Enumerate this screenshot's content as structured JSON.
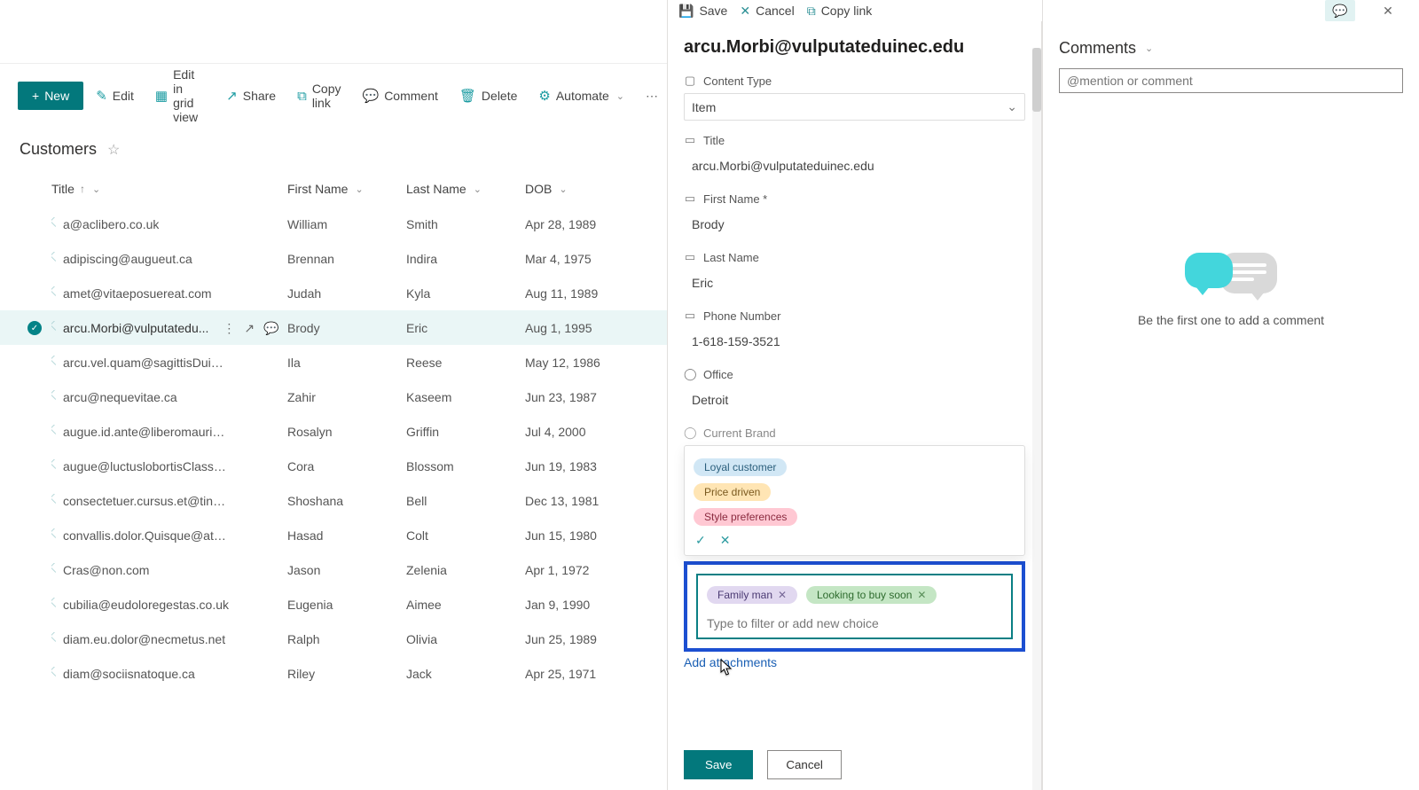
{
  "command_bar": {
    "new": "New",
    "edit": "Edit",
    "edit_grid": "Edit in grid view",
    "share": "Share",
    "copy_link": "Copy link",
    "comment": "Comment",
    "delete": "Delete",
    "automate": "Automate"
  },
  "list": {
    "title": "Customers",
    "columns": {
      "title": "Title",
      "first": "First Name",
      "last": "Last Name",
      "dob": "DOB"
    },
    "rows": [
      {
        "title": "a@aclibero.co.uk",
        "first": "William",
        "last": "Smith",
        "dob": "Apr 28, 1989"
      },
      {
        "title": "adipiscing@augueut.ca",
        "first": "Brennan",
        "last": "Indira",
        "dob": "Mar 4, 1975"
      },
      {
        "title": "amet@vitaeposuereat.com",
        "first": "Judah",
        "last": "Kyla",
        "dob": "Aug 11, 1989"
      },
      {
        "title": "arcu.Morbi@vulputatedu...",
        "first": "Brody",
        "last": "Eric",
        "dob": "Aug 1, 1995",
        "selected": true
      },
      {
        "title": "arcu.vel.quam@sagittisDuisgravida.com",
        "first": "Ila",
        "last": "Reese",
        "dob": "May 12, 1986"
      },
      {
        "title": "arcu@nequevitae.ca",
        "first": "Zahir",
        "last": "Kaseem",
        "dob": "Jun 23, 1987"
      },
      {
        "title": "augue.id.ante@liberomaurisaliquam.co.uk",
        "first": "Rosalyn",
        "last": "Griffin",
        "dob": "Jul 4, 2000"
      },
      {
        "title": "augue@luctuslobortisClass.co.uk",
        "first": "Cora",
        "last": "Blossom",
        "dob": "Jun 19, 1983"
      },
      {
        "title": "consectetuer.cursus.et@tinciduntDonec.co.uk",
        "first": "Shoshana",
        "last": "Bell",
        "dob": "Dec 13, 1981"
      },
      {
        "title": "convallis.dolor.Quisque@at.co.uk",
        "first": "Hasad",
        "last": "Colt",
        "dob": "Jun 15, 1980"
      },
      {
        "title": "Cras@non.com",
        "first": "Jason",
        "last": "Zelenia",
        "dob": "Apr 1, 1972"
      },
      {
        "title": "cubilia@eudoloregestas.co.uk",
        "first": "Eugenia",
        "last": "Aimee",
        "dob": "Jan 9, 1990"
      },
      {
        "title": "diam.eu.dolor@necmetus.net",
        "first": "Ralph",
        "last": "Olivia",
        "dob": "Jun 25, 1989"
      },
      {
        "title": "diam@sociisnatoque.ca",
        "first": "Riley",
        "last": "Jack",
        "dob": "Apr 25, 1971"
      }
    ]
  },
  "detail": {
    "top_actions": {
      "save": "Save",
      "cancel": "Cancel",
      "copy_link": "Copy link"
    },
    "heading": "arcu.Morbi@vulputateduinec.edu",
    "content_type_label": "Content Type",
    "content_type_value": "Item",
    "title_label": "Title",
    "title_value": "arcu.Morbi@vulputateduinec.edu",
    "first_label": "First Name *",
    "first_value": "Brody",
    "last_label": "Last Name",
    "last_value": "Eric",
    "phone_label": "Phone Number",
    "phone_value": "1-618-159-3521",
    "office_label": "Office",
    "office_value": "Detroit",
    "brand_label": "Current Brand",
    "options": {
      "loyal": "Loyal customer",
      "price": "Price driven",
      "style": "Style preferences"
    },
    "selected_tags": {
      "family": "Family man",
      "looking": "Looking to buy soon"
    },
    "filter_placeholder": "Type to filter or add new choice",
    "add_attachments": "Add attachments",
    "save_btn": "Save",
    "cancel_btn": "Cancel"
  },
  "comments": {
    "header": "Comments",
    "placeholder": "@mention or comment",
    "empty": "Be the first one to add a comment"
  }
}
